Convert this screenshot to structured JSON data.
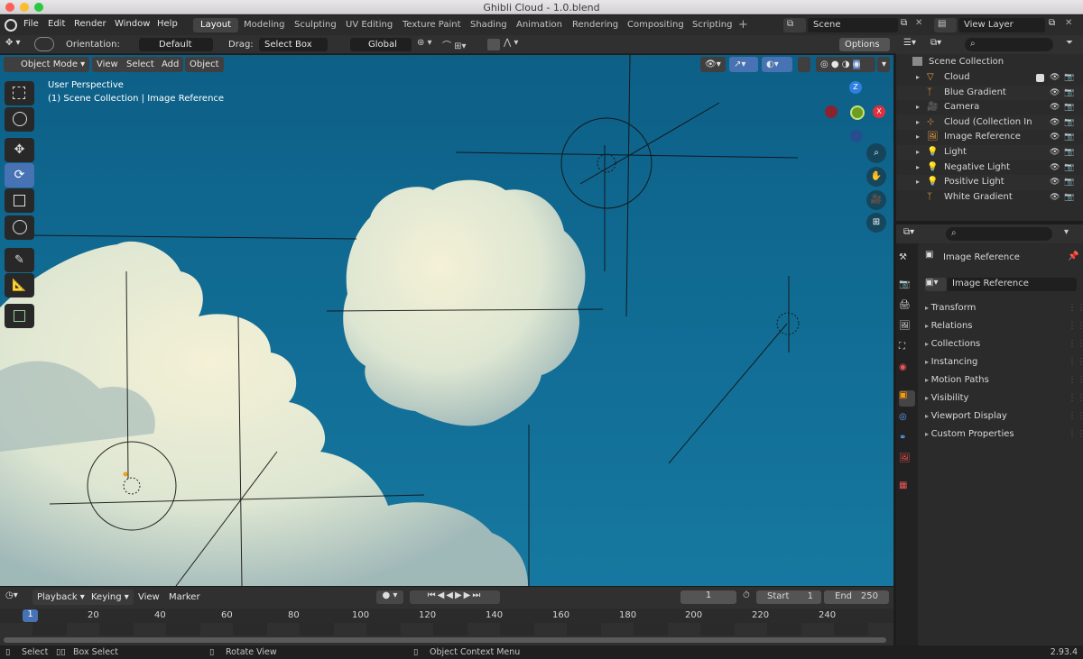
{
  "window": {
    "title": "Ghibli Cloud - 1.0.blend"
  },
  "menu": {
    "items": [
      "File",
      "Edit",
      "Render",
      "Window",
      "Help"
    ]
  },
  "workspaces": [
    "Layout",
    "Modeling",
    "Sculpting",
    "UV Editing",
    "Texture Paint",
    "Shading",
    "Animation",
    "Rendering",
    "Compositing",
    "Scripting"
  ],
  "workspace_add": "+",
  "scene": {
    "name": "Scene",
    "view_layer": "View Layer"
  },
  "toolheader": {
    "orientation_label": "Orientation:",
    "orientation_value": "Default",
    "drag_label": "Drag:",
    "drag_value": "Select Box",
    "transform_space": "Global",
    "options": "Options"
  },
  "viewport": {
    "mode": "Object Mode",
    "menus": [
      "View",
      "Select",
      "Add",
      "Object"
    ],
    "overlay_line1": "User Perspective",
    "overlay_line2": "(1) Scene Collection | Image Reference",
    "gizmo": {
      "z": "Z",
      "x": "X"
    }
  },
  "timeline": {
    "menus": [
      "Playback",
      "Keying",
      "View",
      "Marker"
    ],
    "current_frame": "1",
    "start_label": "Start",
    "start": "1",
    "end_label": "End",
    "end": "250",
    "ruler": [
      "1",
      "20",
      "40",
      "60",
      "80",
      "100",
      "120",
      "140",
      "160",
      "180",
      "200",
      "220",
      "240"
    ]
  },
  "status": {
    "select": "Select",
    "box_select": "Box Select",
    "rotate": "Rotate View",
    "context": "Object Context Menu",
    "version": "2.93.4"
  },
  "outliner": {
    "root": "Scene Collection",
    "items": [
      {
        "name": "Cloud",
        "icon": "mesh-icon",
        "color": "#e8a046",
        "exp": true
      },
      {
        "name": "Blue Gradient",
        "icon": "armature-icon",
        "color": "#e8a046",
        "exp": false
      },
      {
        "name": "Camera",
        "icon": "camera-icon",
        "color": "#e8a046",
        "exp": true
      },
      {
        "name": "Cloud (Collection Insta",
        "icon": "empty-icon",
        "color": "#e8a046",
        "exp": true
      },
      {
        "name": "Image Reference",
        "icon": "image-icon",
        "color": "#e8a046",
        "exp": true
      },
      {
        "name": "Light",
        "icon": "light-icon",
        "color": "#e8a046",
        "exp": true
      },
      {
        "name": "Negative Light",
        "icon": "light-icon",
        "color": "#e8a046",
        "exp": true
      },
      {
        "name": "Positive Light",
        "icon": "light-icon",
        "color": "#e8a046",
        "exp": true
      },
      {
        "name": "White Gradient",
        "icon": "armature-icon",
        "color": "#e8a046",
        "exp": false
      }
    ]
  },
  "properties": {
    "object_name": "Image Reference",
    "datablock": "Image Reference",
    "sections": [
      "Transform",
      "Relations",
      "Collections",
      "Instancing",
      "Motion Paths",
      "Visibility",
      "Viewport Display",
      "Custom Properties"
    ]
  }
}
